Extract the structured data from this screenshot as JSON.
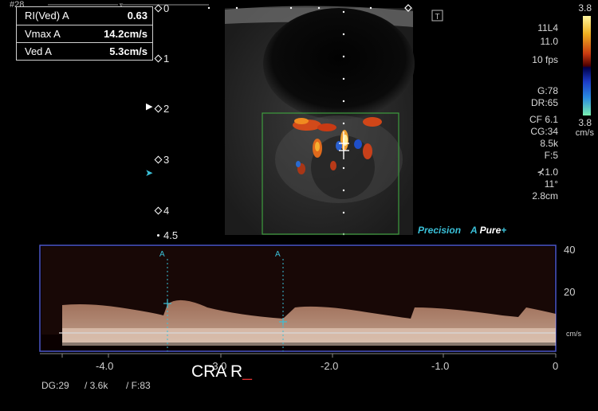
{
  "frame_number": "#28",
  "measurements": [
    {
      "label": "RI(Ved) A",
      "value": "0.63"
    },
    {
      "label": "Vmax A",
      "value": "14.2cm/s"
    },
    {
      "label": "Ved A",
      "value": "5.3cm/s"
    }
  ],
  "depth_marks": [
    "0",
    "1",
    "2",
    "3",
    "4",
    "4.5"
  ],
  "probe": {
    "name": "11L4",
    "frequency": "11.0",
    "frame_rate": "10 fps"
  },
  "gain": {
    "g": "G:78",
    "dr": "DR:65"
  },
  "color_settings": [
    "CF 6.1",
    "CG:34",
    "8.5k",
    "F:5",
    "1.0",
    "11°",
    "2.8cm"
  ],
  "color_scale": {
    "top": "3.8",
    "bottom": "3.8",
    "unit": "cm/s"
  },
  "brand": {
    "precision": "Precision",
    "pure_a": "A",
    "pure_rest": "Pure",
    "pure_plus": "+"
  },
  "doppler": {
    "velocity_ticks": [
      "40",
      "20"
    ],
    "velocity_unit": "cm/s",
    "time_ticks": [
      "-4.0",
      "-3.0",
      "-2.0",
      "-1.0",
      "0"
    ],
    "marker_label": "A"
  },
  "annotation": {
    "text": "CRA R",
    "cursor": "_"
  },
  "footer": {
    "dg": "DG:29",
    "prf": "/ 3.6k",
    "filter": "/ F:83"
  },
  "colors": {
    "doppler_frame": "#4a56c8",
    "color_box": "#3e9d3e",
    "cyan": "#3ac0d8",
    "annotation_cursor": "#e03030"
  }
}
